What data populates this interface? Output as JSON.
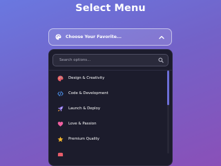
{
  "page": {
    "title": "Select Menu"
  },
  "select": {
    "label": "Choose Your Favorite...",
    "icon": "palette-icon",
    "expanded": true,
    "chevron_icon": "chevron-up-icon"
  },
  "search": {
    "placeholder": "Search options...",
    "value": "",
    "icon": "search-icon"
  },
  "options": [
    {
      "label": "Design & Creativity",
      "icon": "palette-icon",
      "color": "#e85d6a"
    },
    {
      "label": "Code & Development",
      "icon": "code-icon",
      "color": "#4a8fe8"
    },
    {
      "label": "Launch & Deploy",
      "icon": "rocket-icon",
      "color": "#8a6ee8"
    },
    {
      "label": "Love & Passion",
      "icon": "heart-icon",
      "color": "#ef5fa0"
    },
    {
      "label": "Premium Quality",
      "icon": "star-icon",
      "color": "#f5b62c"
    }
  ],
  "colors": {
    "background_start": "#6a78e0",
    "background_end": "#8a50b8",
    "dropdown_bg": "#1c1c2c",
    "accent": "#6d6fd8"
  }
}
